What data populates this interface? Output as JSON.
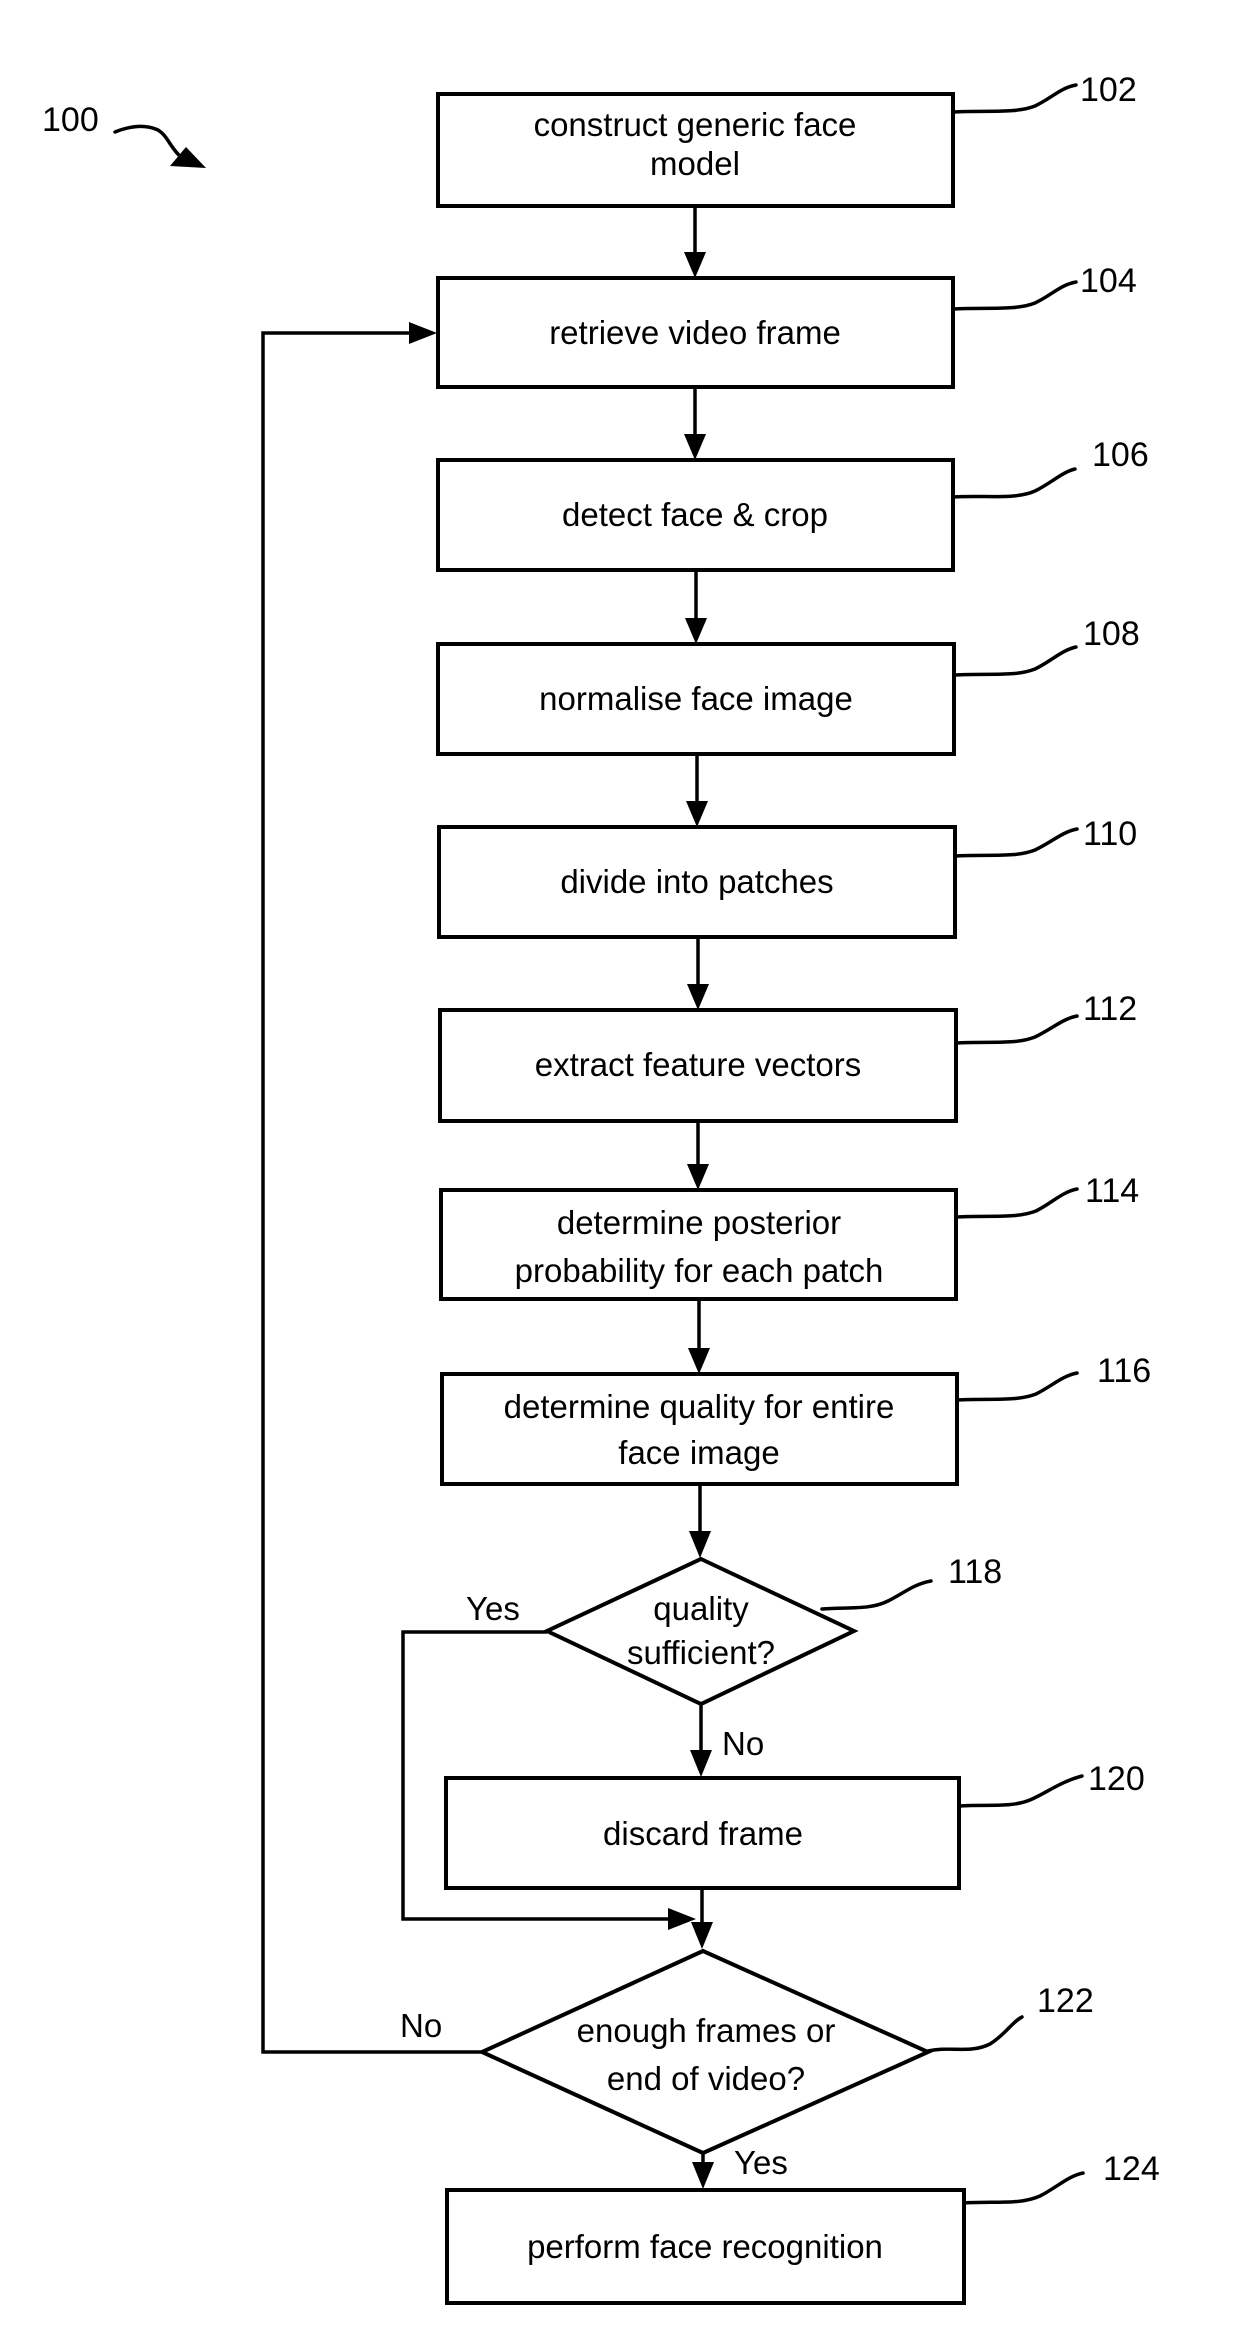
{
  "figure": {
    "reference": "100",
    "steps": [
      {
        "ref": "102",
        "lines": [
          "construct generic face",
          "model"
        ]
      },
      {
        "ref": "104",
        "lines": [
          "retrieve video frame"
        ]
      },
      {
        "ref": "106",
        "lines": [
          "detect face & crop"
        ]
      },
      {
        "ref": "108",
        "lines": [
          "normalise face image"
        ]
      },
      {
        "ref": "110",
        "lines": [
          "divide into patches"
        ]
      },
      {
        "ref": "112",
        "lines": [
          "extract feature vectors"
        ]
      },
      {
        "ref": "114",
        "lines": [
          "determine posterior",
          "probability for each patch"
        ]
      },
      {
        "ref": "116",
        "lines": [
          "determine quality for entire",
          "face image"
        ]
      },
      {
        "ref": "120",
        "lines": [
          "discard frame"
        ]
      },
      {
        "ref": "124",
        "lines": [
          "perform face recognition"
        ]
      }
    ],
    "decisions": [
      {
        "ref": "118",
        "lines": [
          "quality",
          "sufficient?"
        ],
        "yes_label": "Yes",
        "no_label": "No"
      },
      {
        "ref": "122",
        "lines": [
          "enough frames or",
          "end of video?"
        ],
        "yes_label": "Yes",
        "no_label": "No"
      }
    ]
  }
}
